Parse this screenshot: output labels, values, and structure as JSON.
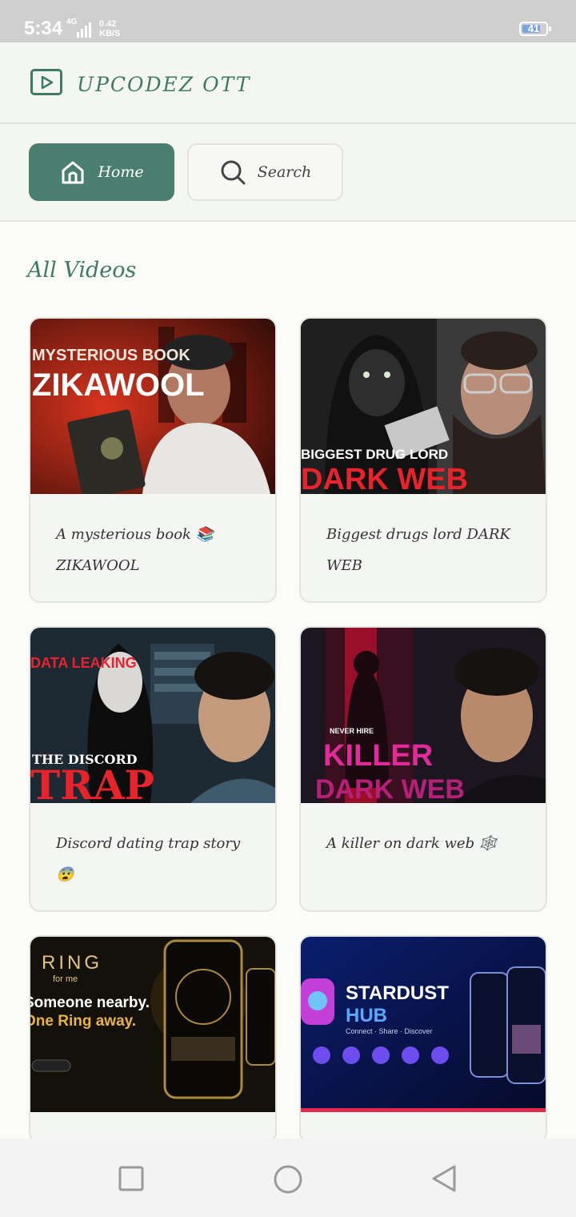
{
  "status": {
    "time": "5:34",
    "network": "4G",
    "speed_value": "0.42",
    "speed_unit": "KB/S",
    "battery": "41"
  },
  "header": {
    "brand": "UPCODEZ OTT"
  },
  "nav": {
    "home_label": "Home",
    "search_label": "Search"
  },
  "section": {
    "title": "All Videos"
  },
  "videos": [
    {
      "thumb_title_1": "MYSTERIOUS BOOK",
      "thumb_title_2": "ZIKAWOOL",
      "caption": "A mysterious book 📚 ZIKAWOOL"
    },
    {
      "thumb_title_1": "BIGGEST DRUG LORD",
      "thumb_title_2": "DARK WEB",
      "caption": "Biggest drugs lord DARK WEB"
    },
    {
      "thumb_title_1": "DATA LEAKING",
      "thumb_title_2": "THE DISCORD",
      "thumb_title_3": "TRAP",
      "caption": "Discord dating trap story 😨"
    },
    {
      "thumb_title_1": "NEVER HIRE",
      "thumb_title_2": "KILLER",
      "thumb_title_3": "DARK WEB",
      "caption": "A killer on dark web 🕸️"
    },
    {
      "thumb_title_1": "RING",
      "thumb_title_2": "for me",
      "thumb_title_3": "Someone nearby.",
      "thumb_title_4": "One Ring away.",
      "caption": ""
    },
    {
      "thumb_title_1": "STARDUST",
      "thumb_title_2": "HUB",
      "thumb_title_3": "Connect · Share · Discover",
      "caption": ""
    }
  ],
  "colors": {
    "accent": "#4a7f6f",
    "brand": "#3f7a69",
    "background": "#fbfbf8"
  }
}
